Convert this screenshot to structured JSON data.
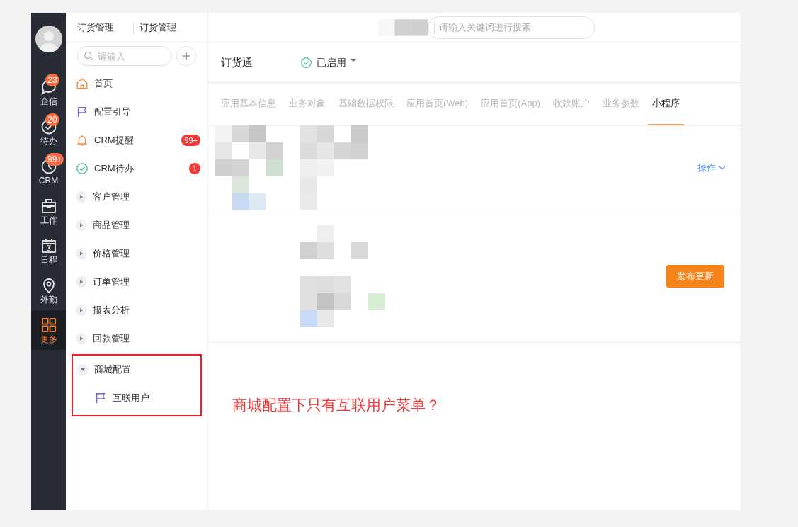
{
  "rail": [
    {
      "label": "企信",
      "badge": "23",
      "selected": false
    },
    {
      "label": "待办",
      "badge": "20",
      "selected": false
    },
    {
      "label": "CRM",
      "badge": "99+",
      "selected": false
    },
    {
      "label": "工作",
      "selected": false
    },
    {
      "label": "日程",
      "selected": false
    },
    {
      "label": "外勤",
      "selected": false
    },
    {
      "label": "更多",
      "selected": true
    }
  ],
  "breadcrumb": [
    "订货管理",
    "订货管理"
  ],
  "global_search": {
    "placeholder": "请输入关键词进行搜索"
  },
  "sidebar": {
    "search": {
      "placeholder": "请输入"
    },
    "items": [
      {
        "kind": "link",
        "label": "首页"
      },
      {
        "kind": "link",
        "label": "配置引导"
      },
      {
        "kind": "link",
        "label": "CRM提醒",
        "badge": "99+"
      },
      {
        "kind": "link",
        "label": "CRM待办",
        "badge": "1"
      },
      {
        "kind": "group",
        "label": "客户管理",
        "expanded": false
      },
      {
        "kind": "group",
        "label": "商品管理",
        "expanded": false
      },
      {
        "kind": "group",
        "label": "价格管理",
        "expanded": false
      },
      {
        "kind": "group",
        "label": "订单管理",
        "expanded": false
      },
      {
        "kind": "group",
        "label": "报表分析",
        "expanded": false
      },
      {
        "kind": "group",
        "label": "回款管理",
        "expanded": false
      },
      {
        "kind": "group",
        "label": "商城配置",
        "expanded": true,
        "children": [
          {
            "label": "互联用户"
          }
        ]
      }
    ]
  },
  "app": {
    "title": "订货通",
    "status": "已启用"
  },
  "tabs": [
    {
      "label": "应用基本信息",
      "selected": false
    },
    {
      "label": "业务对象",
      "selected": false
    },
    {
      "label": "基础数据权限",
      "selected": false
    },
    {
      "label": "应用首页(Web)",
      "selected": false
    },
    {
      "label": "应用首页(App)",
      "selected": false
    },
    {
      "label": "收款账户",
      "selected": false
    },
    {
      "label": "业务参数",
      "selected": false
    },
    {
      "label": "小程序",
      "selected": true
    }
  ],
  "card": {
    "action": "操作"
  },
  "publish_button": "发布更新",
  "annotation": "商城配置下只有互联用户菜单？"
}
